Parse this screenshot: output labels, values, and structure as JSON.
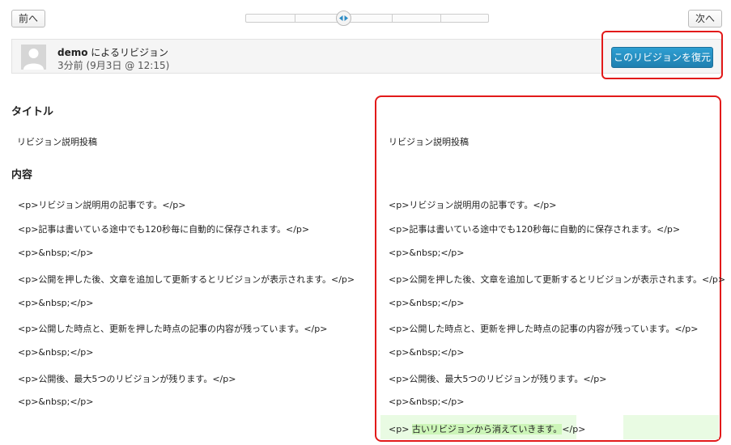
{
  "nav": {
    "prev_label": "前へ",
    "next_label": "次へ"
  },
  "slider": {
    "position": "2/5"
  },
  "revision": {
    "author": "demo",
    "author_suffix": " によるリビジョン",
    "time": "3分前 (9月3日 @ 12:15)"
  },
  "restore_label": "このリビジョンを復元",
  "headings": {
    "title": "タイトル",
    "content": "内容"
  },
  "title_left": "リビジョン説明投稿",
  "title_right": "リビジョン説明投稿",
  "rows": [
    "<p>リビジョン説明用の記事です。</p>",
    "<p>記事は書いている途中でも120秒毎に自動的に保存されます。</p>",
    "<p>&nbsp;</p>",
    "<p>公開を押した後、文章を追加して更新するとリビジョンが表示されます。</p>",
    "<p>&nbsp;</p>",
    "<p>公開した時点と、更新を押した時点の記事の内容が残っています。</p>",
    "<p>&nbsp;</p>",
    "<p>公開後、最大5つのリビジョンが残ります。</p>",
    "<p>&nbsp;</p>"
  ],
  "added": {
    "open": "<p>",
    "text": "古いリビジョンから消えていきます。",
    "close": "</p>"
  }
}
